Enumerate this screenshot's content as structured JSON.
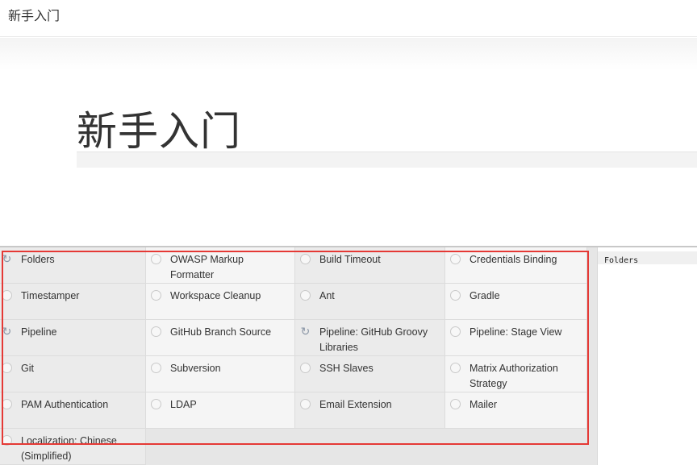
{
  "header": {
    "title": "新手入门"
  },
  "hero": {
    "title": "新手入门"
  },
  "plugins": [
    {
      "label": "Folders",
      "icon": "spinner-icon"
    },
    {
      "label": "OWASP Markup Formatter",
      "icon": "circle-icon"
    },
    {
      "label": "Build Timeout",
      "icon": "circle-icon"
    },
    {
      "label": "Credentials Binding",
      "icon": "circle-icon"
    },
    {
      "label": "Timestamper",
      "icon": "circle-icon"
    },
    {
      "label": "Workspace Cleanup",
      "icon": "circle-icon"
    },
    {
      "label": "Ant",
      "icon": "circle-icon"
    },
    {
      "label": "Gradle",
      "icon": "circle-icon"
    },
    {
      "label": "Pipeline",
      "icon": "spinner-icon"
    },
    {
      "label": "GitHub Branch Source",
      "icon": "circle-icon"
    },
    {
      "label": "Pipeline: GitHub Groovy Libraries",
      "icon": "spinner-icon"
    },
    {
      "label": "Pipeline: Stage View",
      "icon": "circle-icon"
    },
    {
      "label": "Git",
      "icon": "circle-icon"
    },
    {
      "label": "Subversion",
      "icon": "circle-icon"
    },
    {
      "label": "SSH Slaves",
      "icon": "circle-icon"
    },
    {
      "label": "Matrix Authorization Strategy",
      "icon": "circle-icon"
    },
    {
      "label": "PAM Authentication",
      "icon": "circle-icon"
    },
    {
      "label": "LDAP",
      "icon": "circle-icon"
    },
    {
      "label": "Email Extension",
      "icon": "circle-icon"
    },
    {
      "label": "Mailer",
      "icon": "circle-icon"
    },
    {
      "label": "Localization: Chinese (Simplified)",
      "icon": "circle-icon"
    }
  ],
  "details": {
    "current": "Folders"
  },
  "colors": {
    "highlight": "#e53935",
    "spinner": "#8a96a6"
  }
}
